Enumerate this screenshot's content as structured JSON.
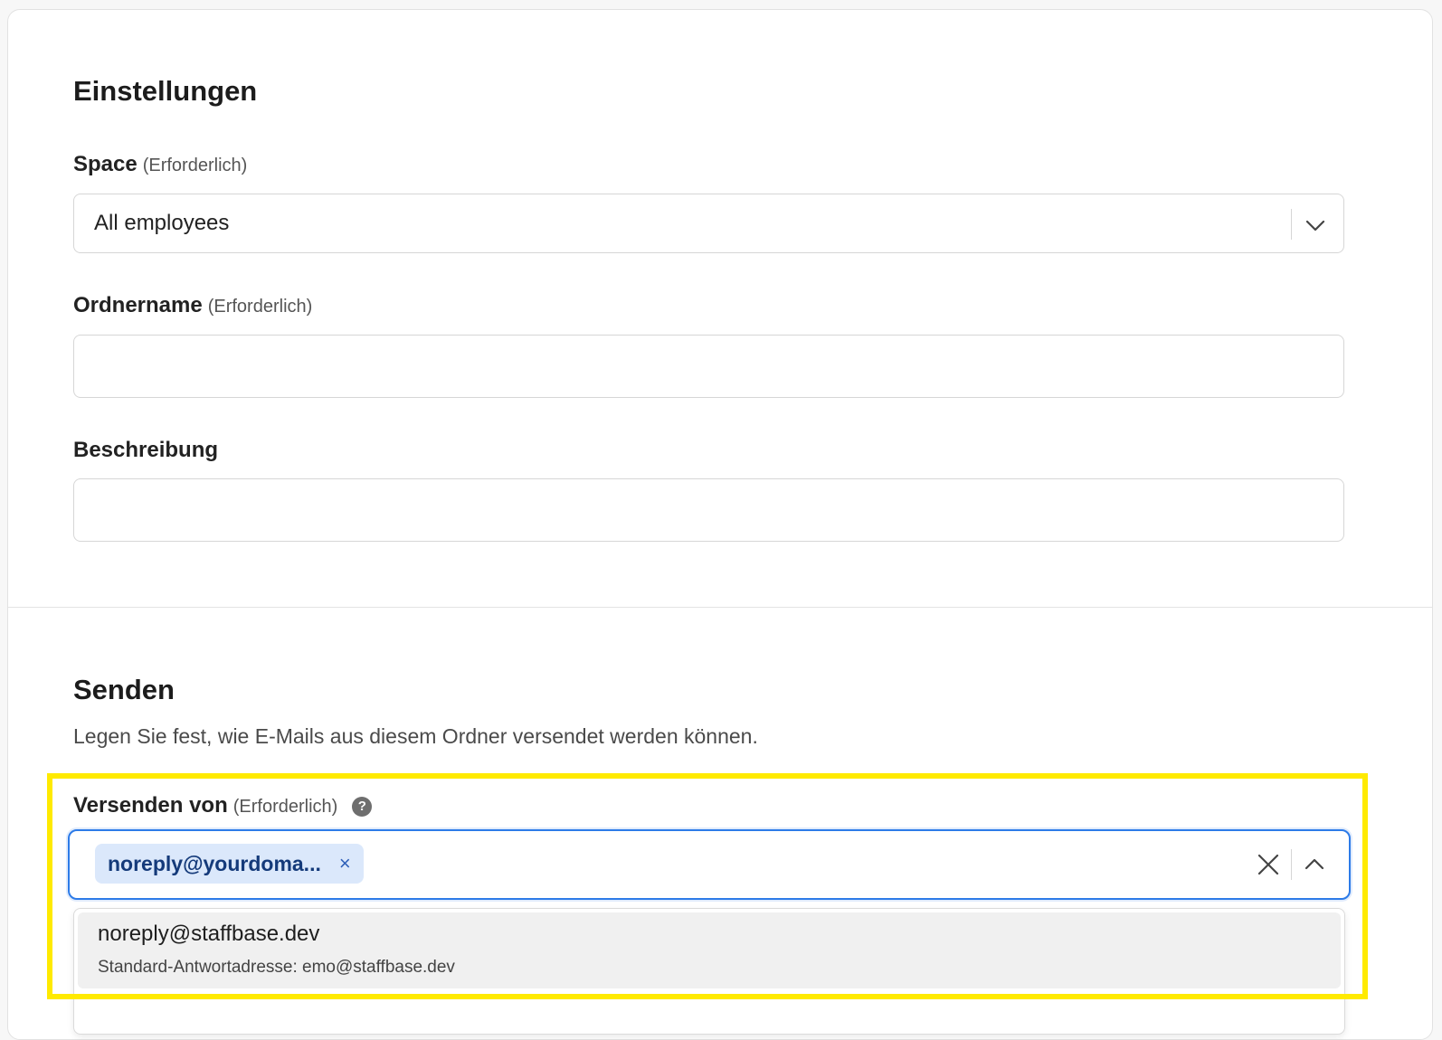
{
  "settings": {
    "title": "Einstellungen",
    "space": {
      "label": "Space",
      "required": "(Erforderlich)",
      "value": "All employees"
    },
    "folder_name": {
      "label": "Ordnername",
      "required": "(Erforderlich)",
      "value": ""
    },
    "description": {
      "label": "Beschreibung",
      "value": ""
    }
  },
  "sending": {
    "title": "Senden",
    "description": "Legen Sie fest, wie E-Mails aus diesem Ordner versendet werden können.",
    "send_from": {
      "label": "Versenden von",
      "required": "(Erforderlich)",
      "help_icon": "?",
      "selected_chip": "noreply@yourdoma...",
      "chip_remove": "×",
      "options": [
        {
          "email": "noreply@staffbase.dev",
          "reply_to": "Standard-Antwortadresse: emo@staffbase.dev"
        }
      ]
    }
  },
  "colors": {
    "focus_border": "#2d7be8",
    "chip_bg": "#dbe8fb",
    "highlight": "#ffea00"
  }
}
